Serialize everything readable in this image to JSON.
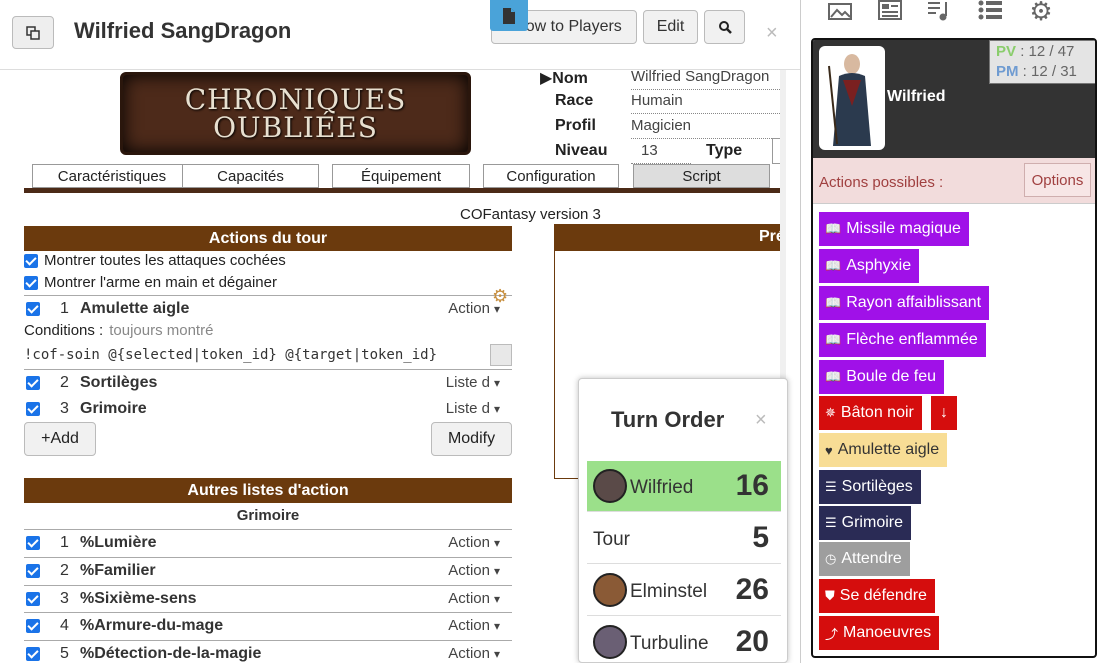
{
  "header": {
    "title": "Wilfried SangDragon",
    "show_players": "Show to Players",
    "edit": "Edit",
    "close": "×"
  },
  "sheet": {
    "logo_line1": "CHRONIQUES",
    "logo_line2": "OUBLIÉES",
    "fields": {
      "nom_label": "▶Nom",
      "nom_value": "Wilfried SangDragon",
      "race_label": "Race",
      "race_value": "Humain",
      "profil_label": "Profil",
      "profil_value": "Magicien",
      "niveau_label": "Niveau",
      "niveau_value": "13",
      "type_label": "Type"
    },
    "tabs": [
      "Caractéristiques",
      "Capacités",
      "Équipement",
      "Configuration",
      "Script"
    ],
    "version": "COFantasy version 3",
    "actions_du_tour": {
      "title": "Actions du tour",
      "options": [
        "Montrer toutes les attaques cochées",
        "Montrer l'arme en main et dégainer"
      ],
      "rows": [
        {
          "num": "1",
          "name": "Amulette aigle",
          "type": "Action"
        },
        {
          "num": "2",
          "name": "Sortilèges",
          "type": "Liste d"
        },
        {
          "num": "3",
          "name": "Grimoire",
          "type": "Liste d"
        }
      ],
      "conditions_label": "Conditions :",
      "conditions_value": "toujours montré",
      "code": "!cof-soin @{selected|token_id} @{target|token_id}",
      "add": "+Add",
      "modify": "Modify"
    },
    "autres": {
      "title": "Autres listes d'action",
      "subtitle": "Grimoire",
      "rows": [
        {
          "num": "1",
          "name": "%Lumière",
          "type": "Action"
        },
        {
          "num": "2",
          "name": "%Familier",
          "type": "Action"
        },
        {
          "num": "3",
          "name": "%Sixième-sens",
          "type": "Action"
        },
        {
          "num": "4",
          "name": "%Armure-du-mage",
          "type": "Action"
        },
        {
          "num": "5",
          "name": "%Détection-de-la-magie",
          "type": "Action"
        }
      ]
    },
    "right_head": "Pré"
  },
  "turn_order": {
    "title": "Turn Order",
    "entries": [
      {
        "name": "Wilfried",
        "score": "16"
      },
      {
        "name": "Tour",
        "score": "5"
      },
      {
        "name": "Elminstel",
        "score": "26"
      },
      {
        "name": "Turbuline",
        "score": "20"
      }
    ]
  },
  "panel": {
    "char_name": "Wilfried",
    "pv_label": "PV",
    "pv_value": ": 12 / 47",
    "pm_label": "PM",
    "pm_value": ": 12 / 31",
    "actions_label": "Actions possibles :",
    "options": "Options",
    "actions": [
      {
        "label": "Missile magique",
        "icon": "book-icon"
      },
      {
        "label": "Asphyxie",
        "icon": "book-icon"
      },
      {
        "label": "Rayon affaiblissant",
        "icon": "book-icon"
      },
      {
        "label": "Flèche enflammée",
        "icon": "book-icon"
      },
      {
        "label": "Boule de feu",
        "icon": "book-icon"
      },
      {
        "label": "Bâton noir",
        "icon": "burst-icon"
      },
      {
        "label": "Amulette aigle",
        "icon": "heart-icon"
      },
      {
        "label": "Sortilèges",
        "icon": "list-icon"
      },
      {
        "label": "Grimoire",
        "icon": "list-icon"
      },
      {
        "label": "Attendre",
        "icon": "clock-icon"
      },
      {
        "label": "Se défendre",
        "icon": "shield-icon"
      },
      {
        "label": "Manoeuvres",
        "icon": "chart-icon"
      }
    ]
  },
  "colors": {
    "brown": "#6b3a0d",
    "purple": "#a011e8",
    "red": "#d50d0d",
    "navy": "#2a2b55",
    "green_current": "#9be08a"
  }
}
